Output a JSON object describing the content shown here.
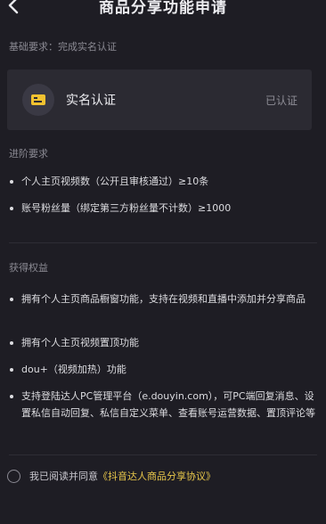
{
  "header": {
    "back_icon": "back-arrow-icon",
    "title": "商品分享功能申请"
  },
  "basic": {
    "hint": "基础要求：完成实名认证",
    "card": {
      "icon": "id-card-icon",
      "label": "实名认证",
      "status": "已认证"
    }
  },
  "advanced": {
    "title": "进阶要求",
    "items": [
      "个人主页视频数（公开且审核通过）≥10条",
      "账号粉丝量（绑定第三方粉丝量不计数）≥1000"
    ]
  },
  "benefits": {
    "title": "获得权益",
    "items": [
      "拥有个人主页商品橱窗功能，支持在视频和直播中添加并分享商品",
      "拥有个人主页视频置顶功能",
      "dou+（视频加热）功能",
      "支持登陆达人PC管理平台（e.douyin.com），可PC端回复消息、设置私信自动回复、私信自定义菜单、查看账号运营数据、置顶评论等"
    ]
  },
  "agreement": {
    "text": "我已阅读并同意",
    "link": "《抖音达人商品分享协议》"
  },
  "colors": {
    "background": "#1e1d24",
    "card": "#2b2a32",
    "accent": "#f2c230",
    "link": "#e7c64a"
  }
}
